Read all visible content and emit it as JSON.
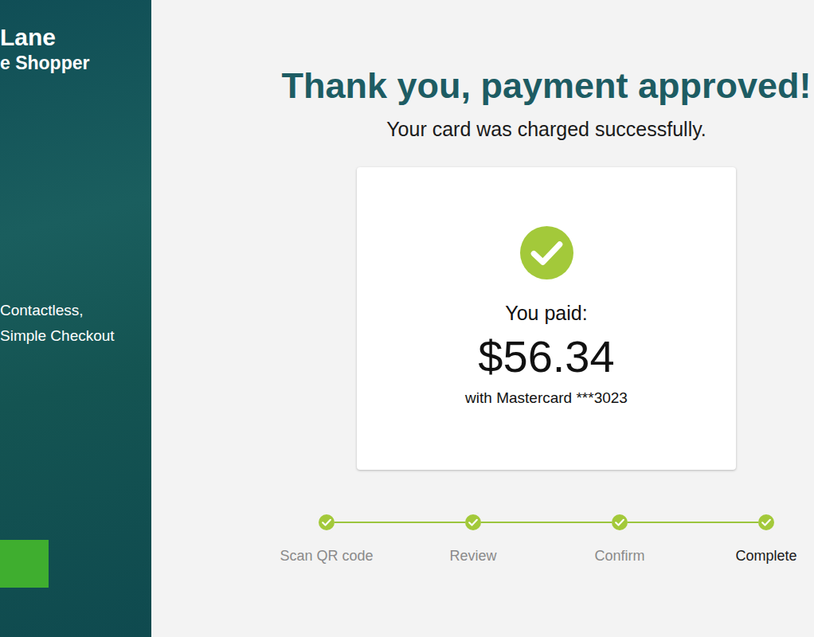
{
  "sidebar": {
    "brand": [
      "Lane",
      "e Shopper"
    ],
    "tagline": [
      "Contactless,",
      "Simple Checkout"
    ]
  },
  "heading": "Thank you, payment approved!",
  "subtitle": "Your card was charged successfully.",
  "receipt": {
    "label": "You paid:",
    "amount": "$56.34",
    "method": "with Mastercard ***3023"
  },
  "steps": [
    {
      "label": "Scan QR code",
      "completed": true,
      "selected": false
    },
    {
      "label": "Review",
      "completed": true,
      "selected": false
    },
    {
      "label": "Confirm",
      "completed": true,
      "selected": false
    },
    {
      "label": "Complete",
      "completed": true,
      "selected": true
    }
  ]
}
